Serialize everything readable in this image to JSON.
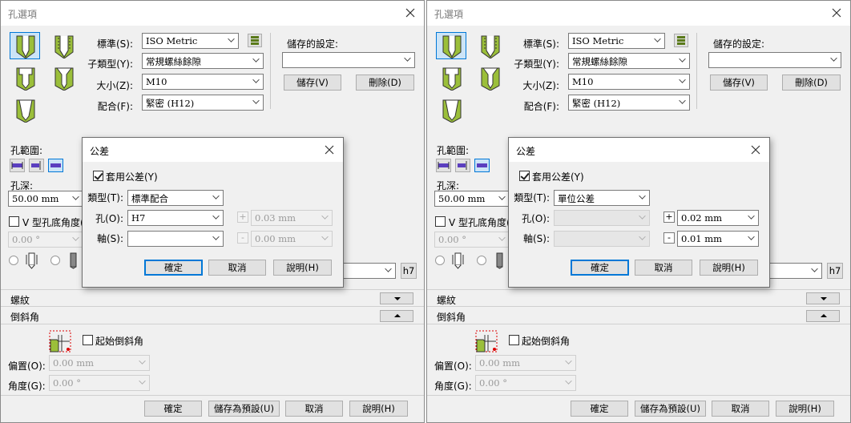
{
  "left": {
    "title": "孔選項",
    "standard_label": "標準(S):",
    "standard_value": "ISO Metric",
    "subtype_label": "子類型(Y):",
    "subtype_value": "常規螺絲餘隙",
    "size_label": "大小(Z):",
    "size_value": "M10",
    "fit_label": "配合(F):",
    "fit_value": "緊密 (H12)",
    "saved_label": "儲存的設定:",
    "saved_value": "",
    "save_btn": "儲存(V)",
    "delete_btn": "刪除(D)",
    "extent_label": "孔範圍:",
    "depth_label": "孔深:",
    "depth_value": "50.00 mm",
    "vbottom_label": "V 型孔底角度(",
    "vbottom_value": "0.00 °",
    "h7_label": "h7",
    "thread_label": "螺紋",
    "chamfer_label": "倒斜角",
    "start_chamfer_label": "起始倒斜角",
    "offset_label": "偏置(O):",
    "offset_value": "0.00 mm",
    "angle_label": "角度(G):",
    "angle_value": "0.00 °",
    "ok_btn": "確定",
    "save_default_btn": "儲存為預設(U)",
    "cancel_btn": "取消",
    "help_btn": "說明(H)",
    "tol": {
      "title": "公差",
      "use_label": "套用公差(Y)",
      "type_label": "類型(T):",
      "type_value": "標準配合",
      "hole_label": "孔(O):",
      "hole_value": "H7",
      "shaft_label": "軸(S):",
      "shaft_value": "",
      "plus_sign": "+",
      "minus_sign": "-",
      "plus_value": "0.03 mm",
      "minus_value": "0.00 mm",
      "ok_btn": "確定",
      "cancel_btn": "取消",
      "help_btn": "說明(H)"
    }
  },
  "right": {
    "title": "孔選項",
    "standard_label": "標準(S):",
    "standard_value": "ISO Metric",
    "subtype_label": "子類型(Y):",
    "subtype_value": "常規螺絲餘隙",
    "size_label": "大小(Z):",
    "size_value": "M10",
    "fit_label": "配合(F):",
    "fit_value": "緊密 (H12)",
    "saved_label": "儲存的設定:",
    "saved_value": "",
    "save_btn": "儲存(V)",
    "delete_btn": "刪除(D)",
    "extent_label": "孔範圍:",
    "depth_label": "孔深:",
    "depth_value": "50.00 mm",
    "vbottom_label": "V 型孔底角度(",
    "vbottom_value": "0.00 °",
    "h7_label": "h7",
    "thread_label": "螺紋",
    "chamfer_label": "倒斜角",
    "start_chamfer_label": "起始倒斜角",
    "offset_label": "偏置(O):",
    "offset_value": "0.00 mm",
    "angle_label": "角度(G):",
    "angle_value": "0.00 °",
    "ok_btn": "確定",
    "save_default_btn": "儲存為預設(U)",
    "cancel_btn": "取消",
    "help_btn": "說明(H)",
    "tol": {
      "title": "公差",
      "use_label": "套用公差(Y)",
      "type_label": "類型(T):",
      "type_value": "單位公差",
      "hole_label": "孔(O):",
      "hole_value": "",
      "shaft_label": "軸(S):",
      "shaft_value": "",
      "plus_sign": "+",
      "minus_sign": "-",
      "plus_value": "0.02 mm",
      "minus_value": "0.01 mm",
      "ok_btn": "確定",
      "cancel_btn": "取消",
      "help_btn": "說明(H)"
    }
  },
  "colors": {
    "hatch_green": "#9bbf3a",
    "selection_blue": "#0078d7",
    "selection_fill": "#cce4f7",
    "dialog_bg": "#f0f0f0"
  }
}
